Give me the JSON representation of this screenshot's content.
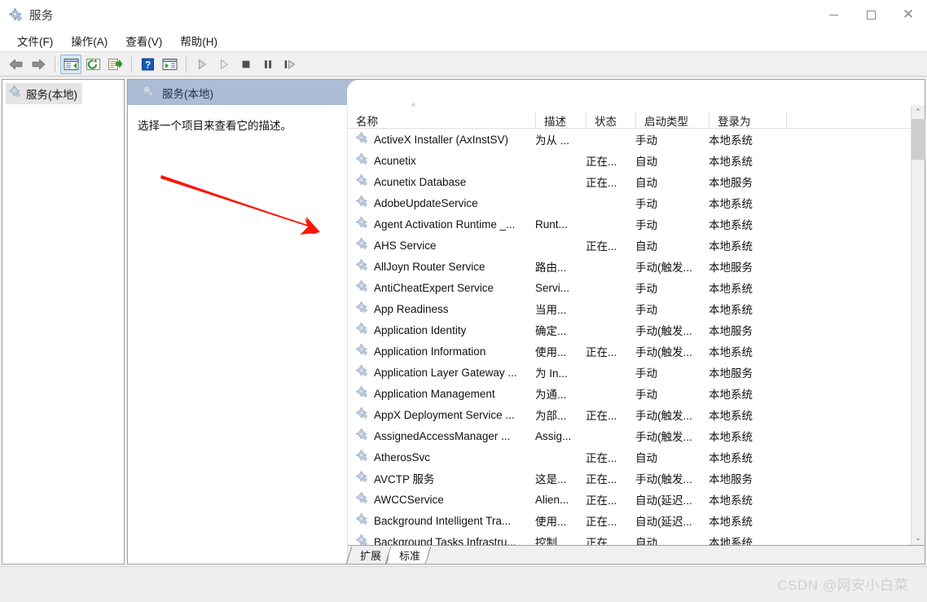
{
  "window": {
    "title": "服务",
    "icon": "gear-icon",
    "controls": {
      "minimize": "—",
      "maximize": "□",
      "close": "✕"
    }
  },
  "menubar": {
    "items": [
      {
        "label": "文件(F)",
        "text": "文件",
        "accel": "F"
      },
      {
        "label": "操作(A)",
        "text": "操作",
        "accel": "A"
      },
      {
        "label": "查看(V)",
        "text": "查看",
        "accel": "V"
      },
      {
        "label": "帮助(H)",
        "text": "帮助",
        "accel": "H"
      }
    ]
  },
  "toolbar": {
    "buttons": [
      {
        "name": "back-icon",
        "glyph": "◀"
      },
      {
        "name": "forward-icon",
        "glyph": "▶"
      },
      {
        "name": "show-hide-tree-icon",
        "glyph": ""
      },
      {
        "name": "refresh-icon",
        "glyph": ""
      },
      {
        "name": "export-list-icon",
        "glyph": ""
      },
      {
        "name": "help-icon",
        "glyph": "?"
      },
      {
        "name": "properties-icon",
        "glyph": ""
      },
      {
        "name": "start-service-icon",
        "glyph": "▷"
      },
      {
        "name": "resume-service-icon",
        "glyph": "▷"
      },
      {
        "name": "stop-service-icon",
        "glyph": "■"
      },
      {
        "name": "pause-service-icon",
        "glyph": "❙❙"
      },
      {
        "name": "restart-service-icon",
        "glyph": "❙▷"
      }
    ]
  },
  "tree": {
    "items": [
      {
        "label": "服务(本地)",
        "selected": true
      }
    ]
  },
  "pane_header": {
    "title": "服务(本地)"
  },
  "description_pane": {
    "text": "选择一个项目来查看它的描述。"
  },
  "columns": [
    {
      "key": "name",
      "label": "名称",
      "sorted": "asc",
      "sort_glyph": "^"
    },
    {
      "key": "description",
      "label": "描述"
    },
    {
      "key": "status",
      "label": "状态"
    },
    {
      "key": "startup",
      "label": "启动类型"
    },
    {
      "key": "logon",
      "label": "登录为"
    }
  ],
  "services": [
    {
      "name": "ActiveX Installer (AxInstSV)",
      "description": "为从 ...",
      "status": "",
      "startup": "手动",
      "logon": "本地系统"
    },
    {
      "name": "Acunetix",
      "description": "",
      "status": "正在...",
      "startup": "自动",
      "logon": "本地系统"
    },
    {
      "name": "Acunetix Database",
      "description": "",
      "status": "正在...",
      "startup": "自动",
      "logon": "本地服务"
    },
    {
      "name": "AdobeUpdateService",
      "description": "",
      "status": "",
      "startup": "手动",
      "logon": "本地系统"
    },
    {
      "name": "Agent Activation Runtime _...",
      "description": "Runt...",
      "status": "",
      "startup": "手动",
      "logon": "本地系统"
    },
    {
      "name": "AHS Service",
      "description": "",
      "status": "正在...",
      "startup": "自动",
      "logon": "本地系统"
    },
    {
      "name": "AllJoyn Router Service",
      "description": "路由...",
      "status": "",
      "startup": "手动(触发...",
      "logon": "本地服务"
    },
    {
      "name": "AntiCheatExpert Service",
      "description": "Servi...",
      "status": "",
      "startup": "手动",
      "logon": "本地系统"
    },
    {
      "name": "App Readiness",
      "description": "当用...",
      "status": "",
      "startup": "手动",
      "logon": "本地系统"
    },
    {
      "name": "Application Identity",
      "description": "确定...",
      "status": "",
      "startup": "手动(触发...",
      "logon": "本地服务"
    },
    {
      "name": "Application Information",
      "description": "使用...",
      "status": "正在...",
      "startup": "手动(触发...",
      "logon": "本地系统"
    },
    {
      "name": "Application Layer Gateway ...",
      "description": "为 In...",
      "status": "",
      "startup": "手动",
      "logon": "本地服务"
    },
    {
      "name": "Application Management",
      "description": "为通...",
      "status": "",
      "startup": "手动",
      "logon": "本地系统"
    },
    {
      "name": "AppX Deployment Service ...",
      "description": "为部...",
      "status": "正在...",
      "startup": "手动(触发...",
      "logon": "本地系统"
    },
    {
      "name": "AssignedAccessManager ...",
      "description": "Assig...",
      "status": "",
      "startup": "手动(触发...",
      "logon": "本地系统"
    },
    {
      "name": "AtherosSvc",
      "description": "",
      "status": "正在...",
      "startup": "自动",
      "logon": "本地系统"
    },
    {
      "name": "AVCTP 服务",
      "description": "这是...",
      "status": "正在...",
      "startup": "手动(触发...",
      "logon": "本地服务"
    },
    {
      "name": "AWCCService",
      "description": "Alien...",
      "status": "正在...",
      "startup": "自动(延迟...",
      "logon": "本地系统"
    },
    {
      "name": "Background Intelligent Tra...",
      "description": "使用...",
      "status": "正在...",
      "startup": "自动(延迟...",
      "logon": "本地系统"
    },
    {
      "name": "Background Tasks Infrastru...",
      "description": "控制...",
      "status": "正在",
      "startup": "自动",
      "logon": "本地系统"
    }
  ],
  "scrollbar": {
    "up_glyph": "⌃",
    "down_glyph": "⌄"
  },
  "tabs": [
    {
      "label": "扩展",
      "selected": false
    },
    {
      "label": "标准",
      "selected": true
    }
  ],
  "watermark": {
    "text": "CSDN @网安小白菜"
  },
  "colors": {
    "header_band": "#adbcd5",
    "toolbar_bg": "#f0f0f0",
    "annotation_arrow": "#fc1505",
    "selection": "#e4e4e4",
    "scroll_thumb": "#cdcdcd"
  }
}
